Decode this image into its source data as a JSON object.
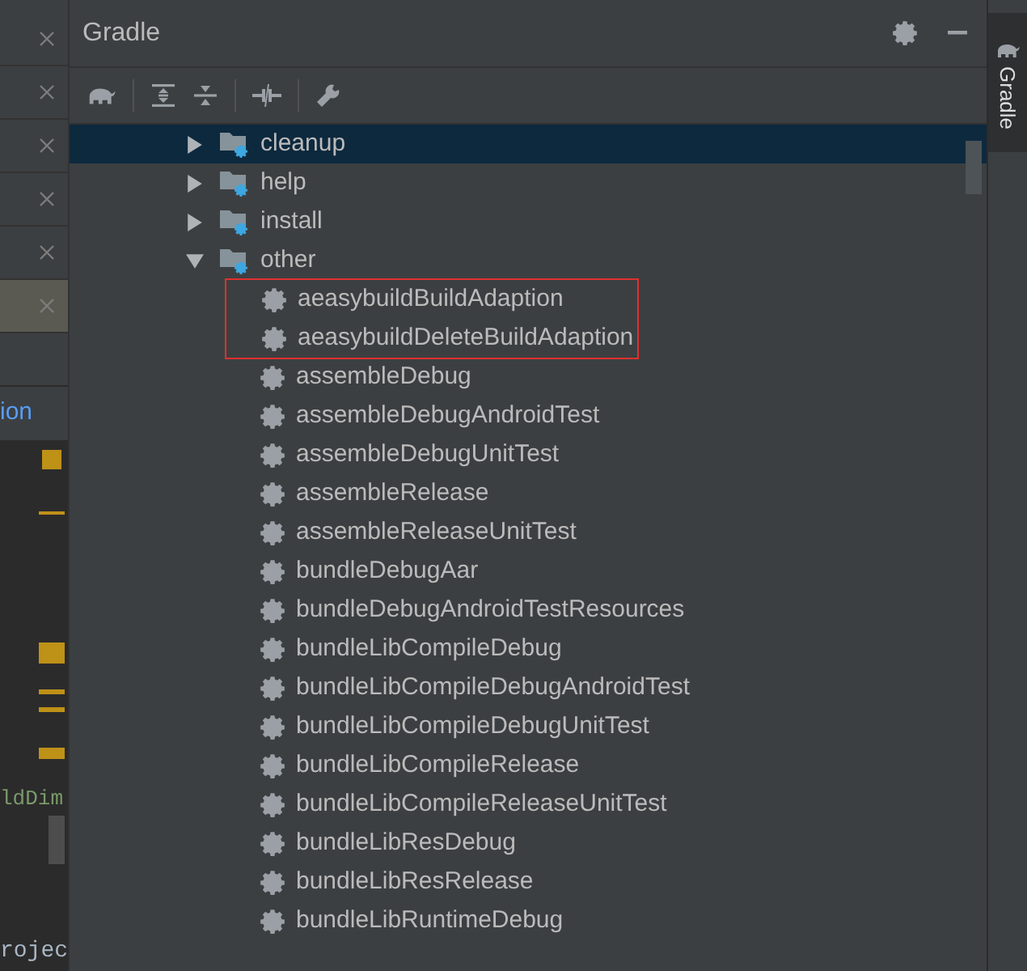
{
  "editor_tabs": [
    {
      "selected": false
    },
    {
      "selected": false
    },
    {
      "selected": false
    },
    {
      "selected": false
    },
    {
      "selected": false
    },
    {
      "selected": true
    }
  ],
  "editor": {
    "tab_label": "ion",
    "code_text": "ldDim",
    "bottom_text": "rojec"
  },
  "panel": {
    "title": "Gradle"
  },
  "tree": [
    {
      "label": "cleanup",
      "expanded": false,
      "selected": true
    },
    {
      "label": "help",
      "expanded": false,
      "selected": false
    },
    {
      "label": "install",
      "expanded": false,
      "selected": false
    },
    {
      "label": "other",
      "expanded": true,
      "selected": false,
      "children": [
        {
          "label": "aeasybuildBuildAdaption",
          "highlighted": true
        },
        {
          "label": "aeasybuildDeleteBuildAdaption",
          "highlighted": true
        },
        {
          "label": "assembleDebug",
          "highlighted": false
        },
        {
          "label": "assembleDebugAndroidTest",
          "highlighted": false
        },
        {
          "label": "assembleDebugUnitTest",
          "highlighted": false
        },
        {
          "label": "assembleRelease",
          "highlighted": false
        },
        {
          "label": "assembleReleaseUnitTest",
          "highlighted": false
        },
        {
          "label": "bundleDebugAar",
          "highlighted": false
        },
        {
          "label": "bundleDebugAndroidTestResources",
          "highlighted": false
        },
        {
          "label": "bundleLibCompileDebug",
          "highlighted": false
        },
        {
          "label": "bundleLibCompileDebugAndroidTest",
          "highlighted": false
        },
        {
          "label": "bundleLibCompileDebugUnitTest",
          "highlighted": false
        },
        {
          "label": "bundleLibCompileRelease",
          "highlighted": false
        },
        {
          "label": "bundleLibCompileReleaseUnitTest",
          "highlighted": false
        },
        {
          "label": "bundleLibResDebug",
          "highlighted": false
        },
        {
          "label": "bundleLibResRelease",
          "highlighted": false
        },
        {
          "label": "bundleLibRuntimeDebug",
          "highlighted": false
        }
      ]
    }
  ],
  "side_tab": {
    "label": "Gradle"
  }
}
